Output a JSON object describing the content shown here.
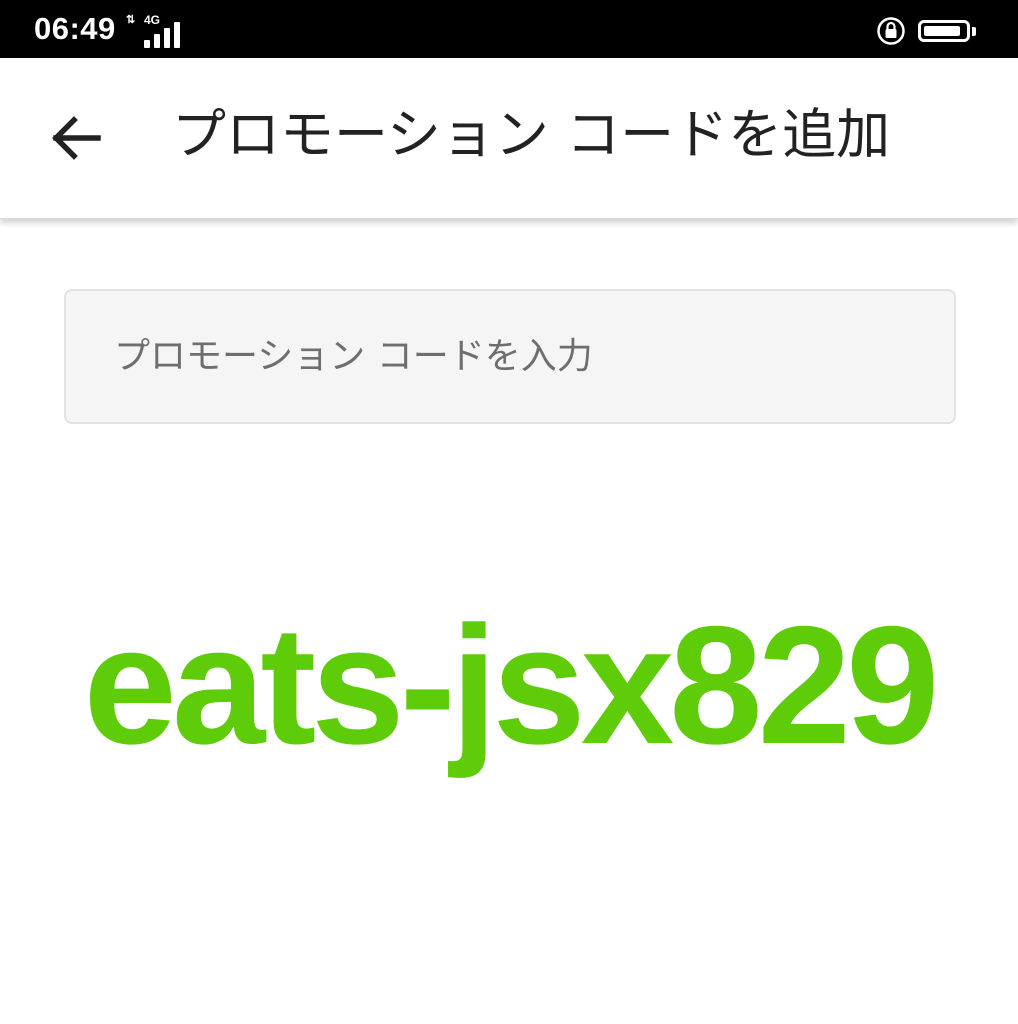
{
  "status_bar": {
    "time": "06:49",
    "network_type": "4G",
    "icons": [
      "data-arrows-icon",
      "signal-strength-icon",
      "rotation-lock-icon",
      "battery-icon"
    ],
    "battery_level": 0.9
  },
  "app_bar": {
    "back_icon": "arrow-left-icon",
    "title": "プロモーション コードを追加"
  },
  "promo_input": {
    "value": "",
    "placeholder": "プロモーション コードを入力"
  },
  "promo_code_overlay": {
    "text": "eats-jsx829",
    "color": "#5fcc0a"
  },
  "colors": {
    "status_bar_bg": "#000000",
    "title_text": "#222222",
    "input_bg": "#f5f5f5",
    "input_border": "#e2e2e2",
    "placeholder_text": "#6e6e6e",
    "accent_green": "#5fcc0a"
  }
}
